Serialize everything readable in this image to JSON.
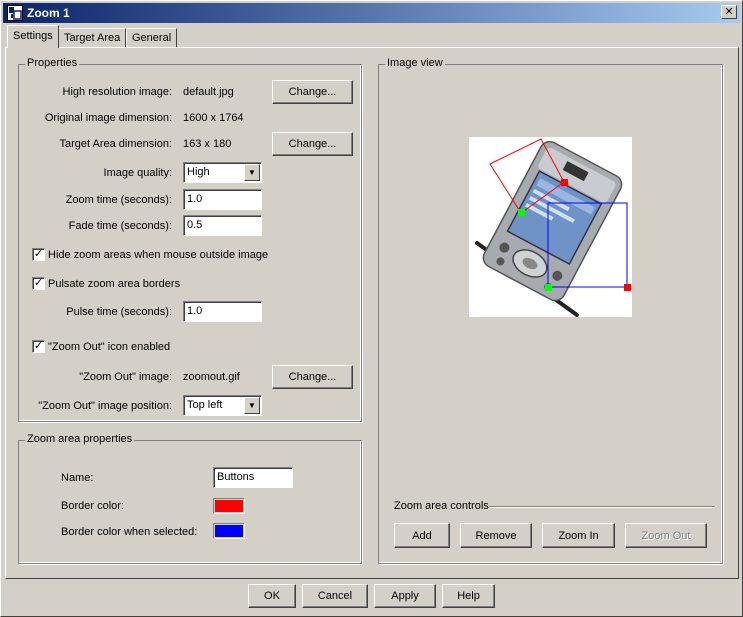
{
  "window": {
    "title": "Zoom 1",
    "close_glyph": "✕"
  },
  "tabs": [
    {
      "label": "Settings",
      "active": true
    },
    {
      "label": "Target Area",
      "active": false
    },
    {
      "label": "General",
      "active": false
    }
  ],
  "properties": {
    "title": "Properties",
    "high_res_label": "High resolution image:",
    "high_res_value": "default.jpg",
    "change_label": "Change...",
    "orig_dim_label": "Original image dimension:",
    "orig_dim_value": "1600 x 1764",
    "target_dim_label": "Target Area dimension:",
    "target_dim_value": "163 x 180",
    "quality_label": "Image quality:",
    "quality_value": "High",
    "zoom_time_label": "Zoom time (seconds):",
    "zoom_time_value": "1.0",
    "fade_time_label": "Fade time (seconds):",
    "fade_time_value": "0.5",
    "hide_zoom_label": "Hide zoom areas when mouse outside image",
    "hide_zoom_checked": true,
    "pulsate_label": "Pulsate zoom area borders",
    "pulsate_checked": true,
    "pulse_time_label": "Pulse time (seconds):",
    "pulse_time_value": "1.0",
    "zoom_out_icon_label": "\"Zoom Out\" icon enabled",
    "zoom_out_icon_checked": true,
    "zoom_out_image_label": "\"Zoom Out\" image:",
    "zoom_out_image_value": "zoomout.gif",
    "zoom_out_pos_label": "\"Zoom Out\" image position:",
    "zoom_out_pos_value": "Top left",
    "check_glyph": "✓",
    "dropdown_glyph": "▼"
  },
  "zoom_area": {
    "title": "Zoom area properties",
    "name_label": "Name:",
    "name_value": "Buttons",
    "border_color_label": "Border color:",
    "border_color": "#ff0000",
    "border_selected_label": "Border color when selected:",
    "border_selected_color": "#0000ff"
  },
  "image_view": {
    "title": "Image view",
    "controls_title": "Zoom area controls",
    "add_label": "Add",
    "remove_label": "Remove",
    "zoom_in_label": "Zoom In",
    "zoom_out_label": "Zoom Out",
    "zoom_out_disabled": true
  },
  "footer": {
    "ok_label": "OK",
    "cancel_label": "Cancel",
    "apply_label": "Apply",
    "help_label": "Help"
  },
  "colors": {
    "handle_green": "#00ff00",
    "handle_red": "#ff0000",
    "selected_border": "#0000ff",
    "unselected_border": "#ff0000"
  }
}
